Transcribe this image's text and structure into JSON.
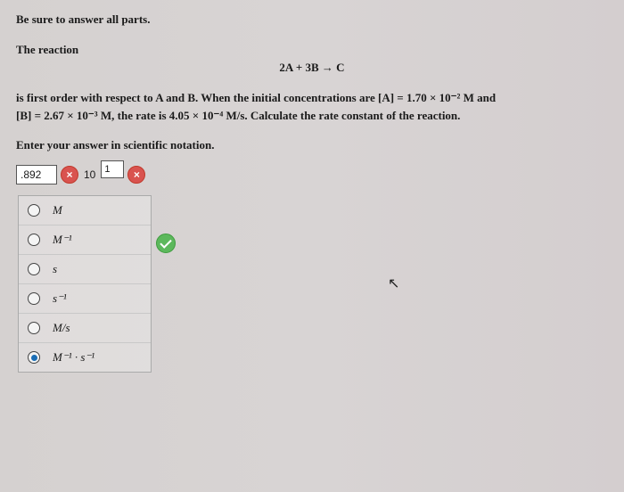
{
  "instruction": "Be sure to answer all parts.",
  "reaction_label": "The reaction",
  "equation": "2A + 3B → C",
  "problem_line1": "is first order with respect to A and B. When the initial concentrations are [A] = 1.70 × 10⁻² M and",
  "problem_line2": "[B] = 2.67 × 10⁻³ M, the rate is 4.05 × 10⁻⁴ M/s. Calculate the rate constant of the reaction.",
  "prompt": "Enter your answer in scientific notation.",
  "answer": {
    "coefficient": ".892",
    "times_base": "10",
    "exponent": "1"
  },
  "units": [
    {
      "label_html": "M",
      "selected": false
    },
    {
      "label_html": "M⁻¹",
      "selected": false
    },
    {
      "label_html": "s",
      "selected": false
    },
    {
      "label_html": "s⁻¹",
      "selected": false
    },
    {
      "label_html": "M/s",
      "selected": false
    },
    {
      "label_html": "M⁻¹ · s⁻¹",
      "selected": true
    }
  ]
}
